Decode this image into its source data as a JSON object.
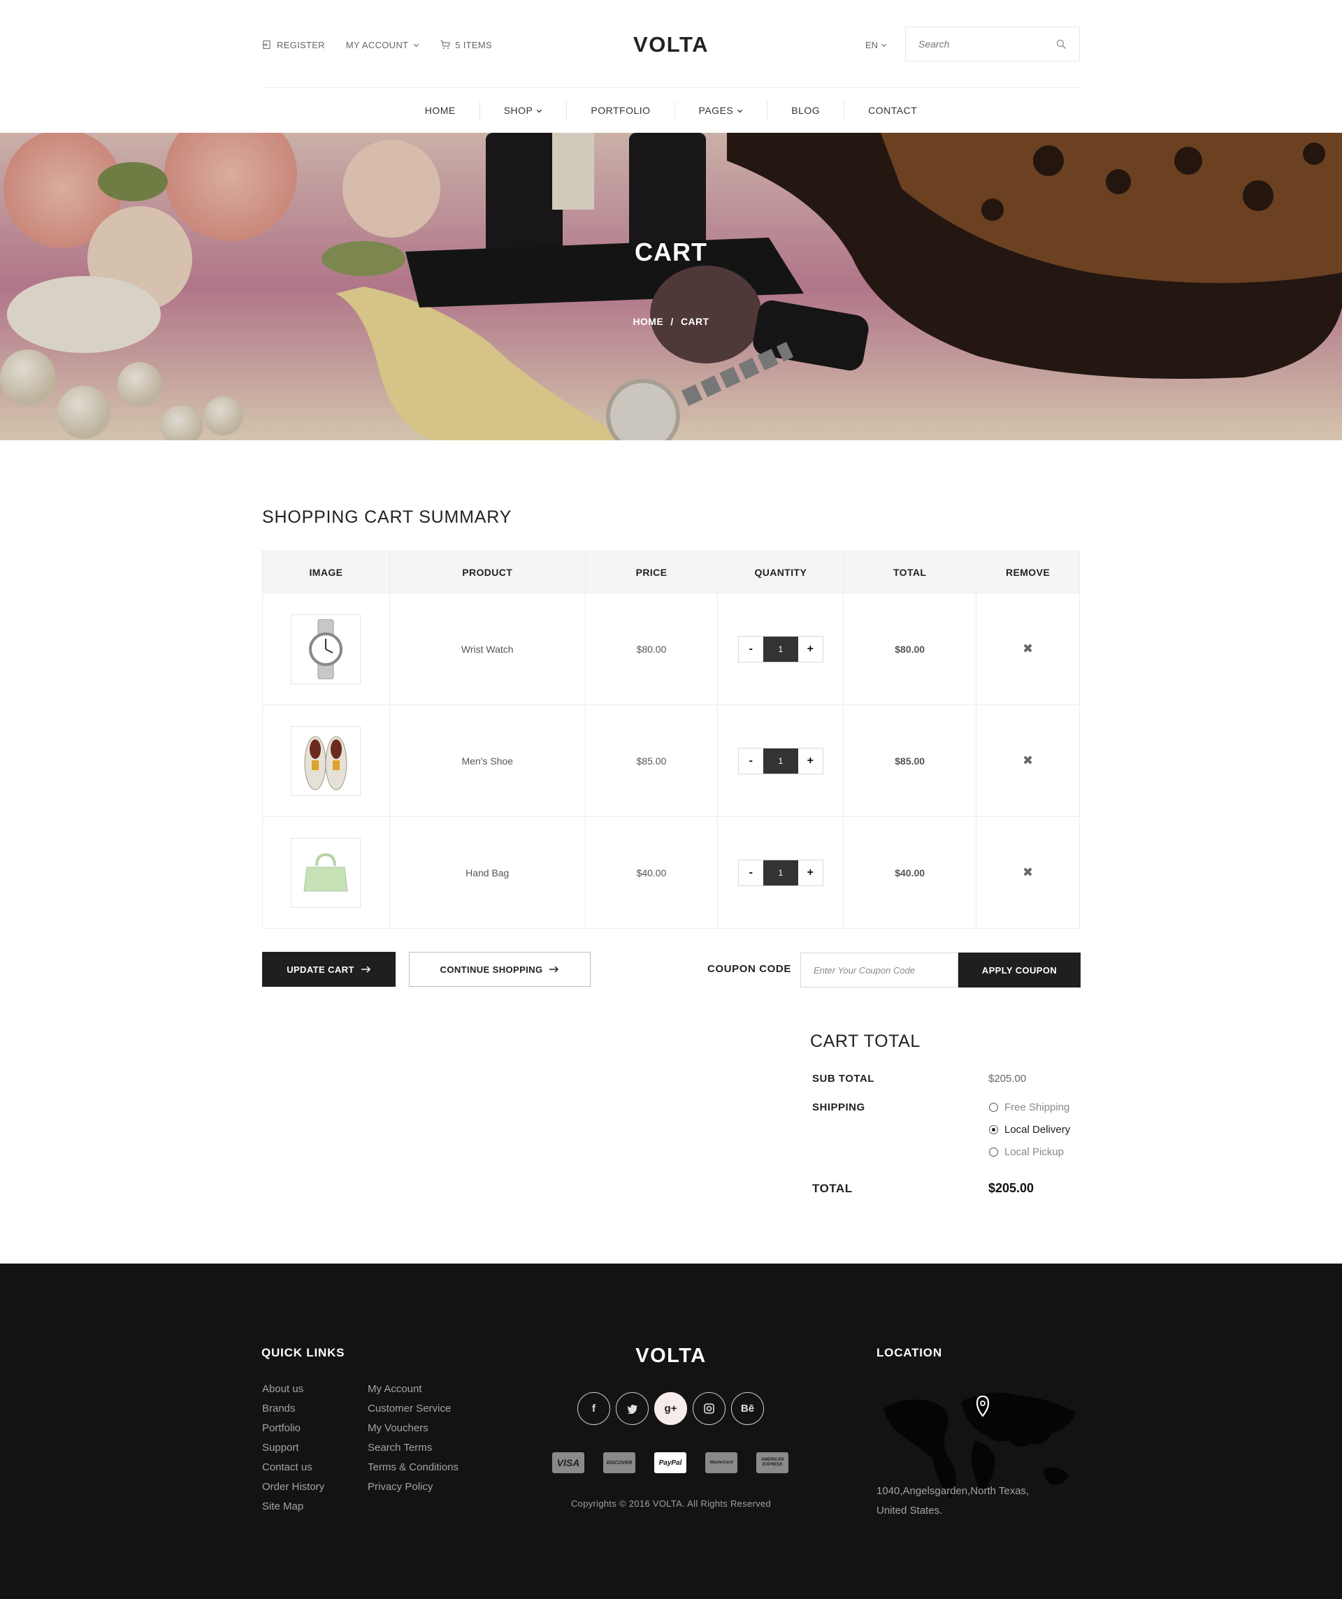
{
  "header": {
    "register_label": "REGISTER",
    "account_label": "MY ACCOUNT",
    "cart_label": "5 ITEMS",
    "logo": "VOLTA",
    "language": "EN",
    "search_placeholder": "Search"
  },
  "nav": {
    "items": [
      {
        "label": "HOME"
      },
      {
        "label": "SHOP"
      },
      {
        "label": "PORTFOLIO"
      },
      {
        "label": "PAGES"
      },
      {
        "label": "BLOG"
      },
      {
        "label": "CONTACT"
      }
    ]
  },
  "banner": {
    "title": "CART",
    "breadcrumb_home": "HOME",
    "breadcrumb_sep": "/",
    "breadcrumb_current": "CART"
  },
  "cart": {
    "title": "SHOPPING CART SUMMARY",
    "columns": [
      "IMAGE",
      "PRODUCT",
      "PRICE",
      "QUANTITY",
      "TOTAL",
      "REMOVE"
    ],
    "rows": [
      {
        "product": "Wrist Watch",
        "price": "$80.00",
        "qty": "1",
        "total": "$80.00",
        "image_icon": "wrist-watch-icon"
      },
      {
        "product": "Men's Shoe",
        "price": "$85.00",
        "qty": "1",
        "total": "$85.00",
        "image_icon": "shoe-icon"
      },
      {
        "product": "Hand Bag",
        "price": "$40.00",
        "qty": "1",
        "total": "$40.00",
        "image_icon": "handbag-icon"
      }
    ],
    "minus": "-",
    "plus": "+",
    "remove_glyph": "✖",
    "update_label": "UPDATE CART",
    "continue_label": "CONTINUE SHOPPING",
    "coupon_label": "COUPON CODE",
    "coupon_placeholder": "Enter Your Coupon Code",
    "apply_label": "APPLY COUPON"
  },
  "cart_total": {
    "title": "CART TOTAL",
    "subtotal_label": "SUB TOTAL",
    "subtotal_value": "$205.00",
    "shipping_label": "SHIPPING",
    "shipping_options": [
      {
        "label": "Free Shipping",
        "selected": false
      },
      {
        "label": "Local Delivery",
        "selected": true
      },
      {
        "label": "Local Pickup",
        "selected": false
      }
    ],
    "total_label": "TOTAL",
    "total_value": "$205.00"
  },
  "footer": {
    "quick_links_title": "QUICK LINKS",
    "links_col1": [
      "About us",
      "Brands",
      "Portfolio",
      "Support",
      "Contact us",
      "Order History",
      "Site Map"
    ],
    "links_col2": [
      "My Account",
      "Customer Service",
      "My Vouchers",
      "Search Terms",
      "Terms & Conditions",
      "Privacy Policy"
    ],
    "logo": "VOLTA",
    "social_icons": [
      "facebook-icon",
      "twitter-icon",
      "google-plus-icon",
      "instagram-icon",
      "behance-icon"
    ],
    "payment_icons": [
      "visa-card-icon",
      "discover-card-icon",
      "paypal-card-icon",
      "mastercard-icon",
      "american-express-icon"
    ],
    "payment_labels": [
      "VISA",
      "DISCOVER",
      "PayPal",
      "MasterCard",
      "AMERICAN EXPRESS"
    ],
    "copyright": "Copyrights © 2016 VOLTA. All Rights Reserved",
    "location_title": "LOCATION",
    "address_line1": "1040,Angelsgarden,North Texas,",
    "address_line2": "United States."
  },
  "colors": {
    "dark": "#1f1f1f",
    "footer_bg": "#131313",
    "accent_pink": "#f7ecec"
  }
}
